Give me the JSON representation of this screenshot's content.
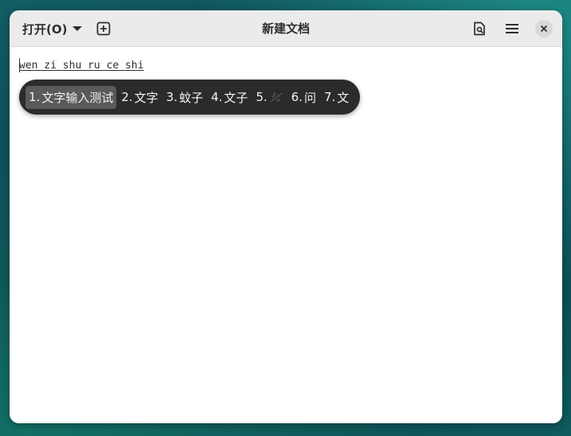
{
  "window": {
    "title": "新建文档"
  },
  "headerbar": {
    "open_label": "打开(O)",
    "icons": {
      "new_tab": "new-tab-icon",
      "save": "save-document-icon",
      "menu": "hamburger-menu-icon",
      "close": "close-icon"
    }
  },
  "editor": {
    "preedit_text": "wen zi shu ru ce shi"
  },
  "candidates": [
    {
      "num": "1.",
      "text": "文字输入测试",
      "selected": true
    },
    {
      "num": "2.",
      "text": "文字",
      "selected": false
    },
    {
      "num": "3.",
      "text": "蚊子",
      "selected": false
    },
    {
      "num": "4.",
      "text": "文子",
      "selected": false
    },
    {
      "num": "5.",
      "text": "",
      "emoji": "mosquito-emoji",
      "selected": false
    },
    {
      "num": "6.",
      "text": "问",
      "selected": false
    },
    {
      "num": "7.",
      "text": "文",
      "selected": false
    }
  ],
  "colors": {
    "headerbar_bg": "#ebebeb",
    "popup_bg": "#2b2b2b",
    "popup_selected_bg": "#5a5a5a",
    "popup_text": "#f2f2f2"
  }
}
